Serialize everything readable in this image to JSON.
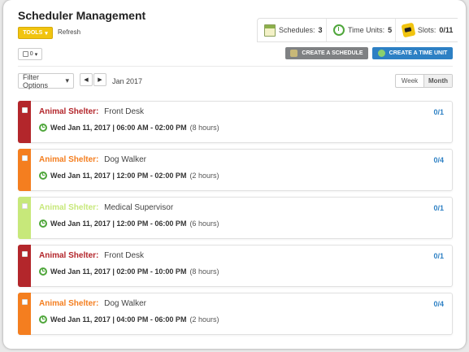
{
  "header": {
    "title": "Scheduler Management",
    "tools_label": "TOOLS",
    "tools_caret": "▾",
    "refresh_label": "Refresh"
  },
  "stats": {
    "schedules_label": "Schedules:",
    "schedules_value": "3",
    "time_units_label": "Time Units:",
    "time_units_value": "5",
    "slots_label": "Slots:",
    "slots_value": "0/11"
  },
  "toolbar": {
    "select_count": "0",
    "select_caret": "▾",
    "create_schedule": "CREATE A SCHEDULE",
    "create_time_unit": "CREATE A TIME UNIT"
  },
  "nav": {
    "filter_label": "Filter Options",
    "filter_caret": "▾",
    "prev": "◀",
    "next": "▶",
    "date_label": "Jan 2017",
    "view_week": "Week",
    "view_month": "Month"
  },
  "colors": {
    "tools": "#f1c40f",
    "accent_blue": "#2d80c4",
    "darkred": "#b3262b",
    "orange": "#f47e1f",
    "lightgreen": "#c7e87a"
  },
  "entries": [
    {
      "org": "Animal Shelter:",
      "role": "Front Desk",
      "when": "Wed Jan 11, 2017 | 06:00 AM - 02:00 PM",
      "duration": "(8 hours)",
      "count": "0/1",
      "color": "#b3262b"
    },
    {
      "org": "Animal Shelter:",
      "role": "Dog Walker",
      "when": "Wed Jan 11, 2017 | 12:00 PM - 02:00 PM",
      "duration": "(2 hours)",
      "count": "0/4",
      "color": "#f47e1f"
    },
    {
      "org": "Animal Shelter:",
      "role": "Medical Supervisor",
      "when": "Wed Jan 11, 2017 | 12:00 PM - 06:00 PM",
      "duration": "(6 hours)",
      "count": "0/1",
      "color": "#c7e87a"
    },
    {
      "org": "Animal Shelter:",
      "role": "Front Desk",
      "when": "Wed Jan 11, 2017 | 02:00 PM - 10:00 PM",
      "duration": "(8 hours)",
      "count": "0/1",
      "color": "#b3262b"
    },
    {
      "org": "Animal Shelter:",
      "role": "Dog Walker",
      "when": "Wed Jan 11, 2017 | 04:00 PM - 06:00 PM",
      "duration": "(2 hours)",
      "count": "0/4",
      "color": "#f47e1f"
    }
  ]
}
